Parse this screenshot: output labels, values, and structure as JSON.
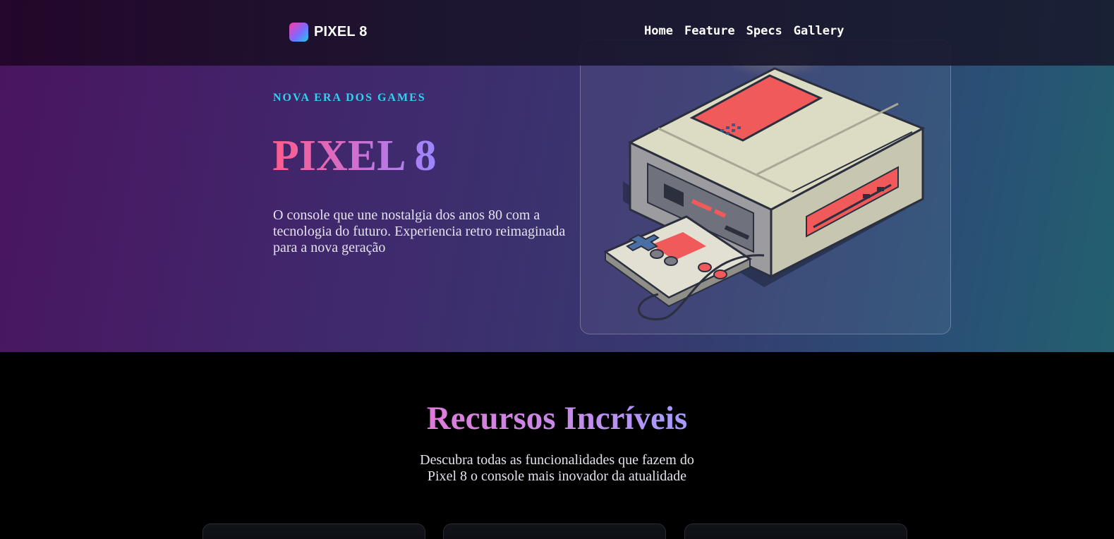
{
  "nav": {
    "brand": "PIXEL 8",
    "links": [
      "Home",
      "Feature",
      "Specs",
      "Gallery"
    ]
  },
  "hero": {
    "eyebrow": "NOVA ERA DOS GAMES",
    "title": "PIXEL 8",
    "description": "O console que une nostalgia dos anos 80 com a tecnologia do futuro. Experiencia retro reimaginada para a nova geração",
    "image_alt": "pixel-art retro game console with controller"
  },
  "features": {
    "title": "Recursos Incríveis",
    "subtitle_line1": "Descubra todas as funcionalidades que fazem do",
    "subtitle_line2": "Pixel 8 o console mais inovador da atualidade"
  },
  "colors": {
    "accent_cyan": "#2ed3ef",
    "accent_pink": "#ff5c8a",
    "accent_purple": "#9b86ff",
    "console_red": "#f15a5a",
    "console_body": "#dcdcc4"
  }
}
